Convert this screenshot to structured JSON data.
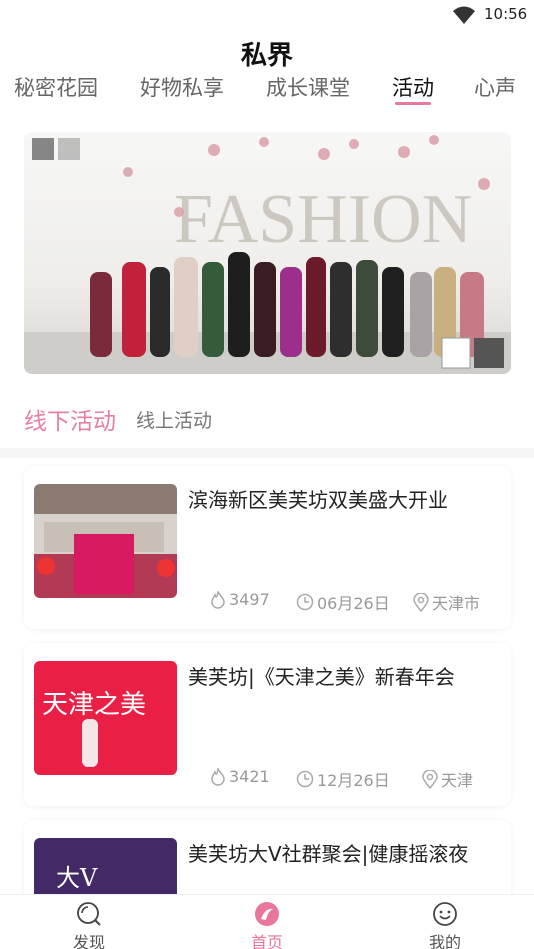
{
  "status_bar": {
    "time": "10:56"
  },
  "app": {
    "title": "私界"
  },
  "tabs": [
    {
      "label": "秘密花园",
      "active": false
    },
    {
      "label": "好物私享",
      "active": false
    },
    {
      "label": "成长课堂",
      "active": false
    },
    {
      "label": "活动",
      "active": true
    },
    {
      "label": "心声",
      "active": false
    }
  ],
  "sub_tabs": {
    "offline": "线下活动",
    "online": "线上活动"
  },
  "activities": [
    {
      "title": "滨海新区美芙坊双美盛大开业",
      "views": "3497",
      "date": "06月26日",
      "location": "天津市"
    },
    {
      "title": "美芙坊|《天津之美》新春年会",
      "views": "3421",
      "date": "12月26日",
      "location": "天津"
    },
    {
      "title": "美芙坊大V社群聚会|健康摇滚夜"
    }
  ],
  "bottom_nav": [
    {
      "label": "发现",
      "active": false
    },
    {
      "label": "首页",
      "active": true
    },
    {
      "label": "我的",
      "active": false
    }
  ],
  "colors": {
    "accent": "#e879a1",
    "inactive_text": "#666666",
    "meta_text": "#999999"
  }
}
